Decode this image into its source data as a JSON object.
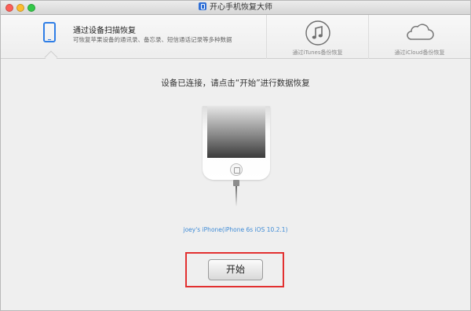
{
  "window": {
    "title": "开心手机恢复大师"
  },
  "tabs": {
    "device_scan": {
      "title": "通过设备扫描恢复",
      "description": "可恢复苹果设备的通讯录、备忘录、短信通话记录等多种数据",
      "icon": "iphone-icon"
    },
    "itunes": {
      "label": "通过iTunes备份恢复",
      "icon": "music-note-icon"
    },
    "icloud": {
      "label": "通过iCloud备份恢复",
      "icon": "cloud-icon"
    }
  },
  "main": {
    "instruction": "设备已连接，请点击“开始”进行数据恢复",
    "device_label": "joey's iPhone(iPhone 6s iOS 10.2.1)",
    "start_label": "开始"
  },
  "colors": {
    "accent": "#2f7ee6",
    "link": "#3f8bd6",
    "highlight": "#e23030"
  }
}
